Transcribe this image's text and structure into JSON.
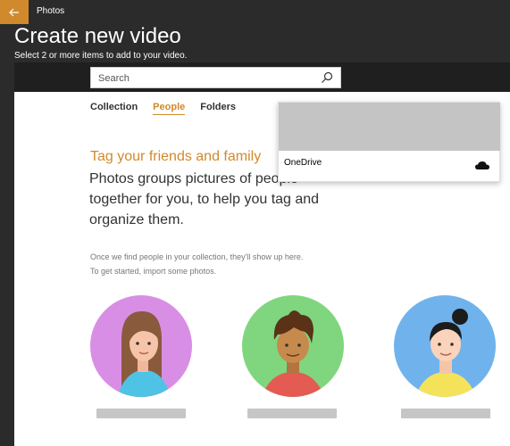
{
  "window": {
    "app_title": "Photos"
  },
  "header": {
    "title": "Create new video",
    "subtitle": "Select 2 or more items to add to your video."
  },
  "search": {
    "placeholder": "Search",
    "value": ""
  },
  "tabs": [
    {
      "label": "Collection",
      "active": false
    },
    {
      "label": "People",
      "active": true
    },
    {
      "label": "Folders",
      "active": false
    }
  ],
  "content": {
    "heading": "Tag your friends and family",
    "description": "Photos groups pictures of people together for you, to help you tag and organize them.",
    "note_line1": "Once we find people in your collection, they'll show up here.",
    "note_line2": "To get started, import some photos."
  },
  "popup": {
    "label": "OneDrive",
    "icon": "onedrive-cloud-icon"
  },
  "colors": {
    "accent": "#d08a2c",
    "background": "#2b2b2b"
  }
}
